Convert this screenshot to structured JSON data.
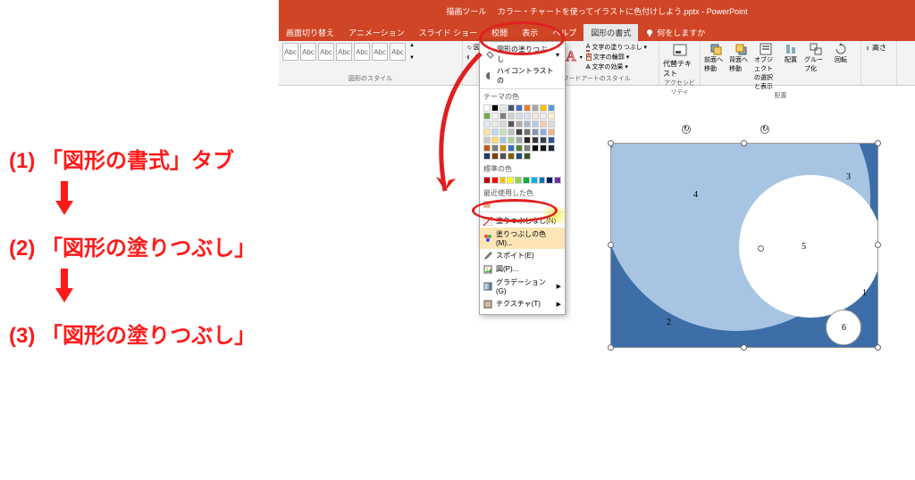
{
  "title_bar": {
    "tool_label": "描画ツール",
    "filename": "カラー・チャートを使ってイラストに色付けしよう.pptx",
    "app": "PowerPoint"
  },
  "tabs": [
    "画面切り替え",
    "アニメーション",
    "スライド ショー",
    "校閲",
    "表示",
    "ヘルプ",
    "図形の書式"
  ],
  "tab_search": "何をしますか",
  "ribbon": {
    "shape_styles_label": "図形のスタイル",
    "fill_button": "図形の塗りつぶし",
    "highcontrast": "ハイコントラストの",
    "wordart_label": "ワードアートのスタイル",
    "text_fill": "文字の塗りつぶし",
    "text_outline": "文字の輪郭",
    "text_effects": "文字の効果",
    "alt_text": "代替テキスト",
    "accessibility_label": "アクセシビリティ",
    "arrange_label": "配置",
    "arrange_items": [
      "前面へ移動",
      "背面へ移動",
      "オブジェクトの選択と表示",
      "配置",
      "グループ化",
      "回転"
    ],
    "size_height": "高さ"
  },
  "dropdown": {
    "theme_colors": "テーマの色",
    "standard_colors": "標準の色",
    "recent_colors": "最近使用した色",
    "no_fill": "塗りつぶしなし(N)",
    "more_colors": "塗りつぶしの色(M)...",
    "eyedropper": "スポイト(E)",
    "picture": "図(P)...",
    "gradient": "グラデーション(G)",
    "texture": "テクスチャ(T)",
    "theme_palette": [
      [
        "#ffffff",
        "#000000",
        "#e7e6e6",
        "#44546a",
        "#4472c4",
        "#ed7d31",
        "#a5a5a5",
        "#ffc000",
        "#5b9bd5",
        "#70ad47"
      ],
      [
        "#f2f2f2",
        "#7f7f7f",
        "#d0cece",
        "#d6dce5",
        "#d9e2f3",
        "#fbe5d6",
        "#ededed",
        "#fff2cc",
        "#deebf7",
        "#e2f0d9"
      ],
      [
        "#d9d9d9",
        "#595959",
        "#aeabab",
        "#adb9ca",
        "#b4c7e7",
        "#f7cbac",
        "#dbdbdb",
        "#fee599",
        "#bdd7ee",
        "#c5e0b4"
      ],
      [
        "#bfbfbf",
        "#404040",
        "#757070",
        "#8497b0",
        "#8eaadb",
        "#f4b183",
        "#c9c9c9",
        "#ffd965",
        "#9dc3e6",
        "#a9d18e"
      ],
      [
        "#a6a6a6",
        "#262626",
        "#3a3838",
        "#323f4f",
        "#2f5597",
        "#c55a11",
        "#7b7b7b",
        "#bf9000",
        "#2e75b6",
        "#548235"
      ],
      [
        "#7f7f7f",
        "#0d0d0d",
        "#171616",
        "#222a35",
        "#1f3864",
        "#843c0b",
        "#525252",
        "#7f6000",
        "#1f4e79",
        "#385723"
      ]
    ],
    "standard_palette": [
      "#c00000",
      "#ff0000",
      "#ffc000",
      "#ffff00",
      "#92d050",
      "#00b050",
      "#00b0f0",
      "#0070c0",
      "#002060",
      "#7030a0"
    ],
    "recent_palette": [
      "#f4b183"
    ]
  },
  "canvas_labels": {
    "1": "1",
    "2": "2",
    "3": "3",
    "4": "4",
    "5": "5",
    "6": "6"
  },
  "instructions": {
    "step1": "(1) 「図形の書式」タブ",
    "step2": "(2) 「図形の塗りつぶし」",
    "step3": "(3) 「図形の塗りつぶし」"
  }
}
